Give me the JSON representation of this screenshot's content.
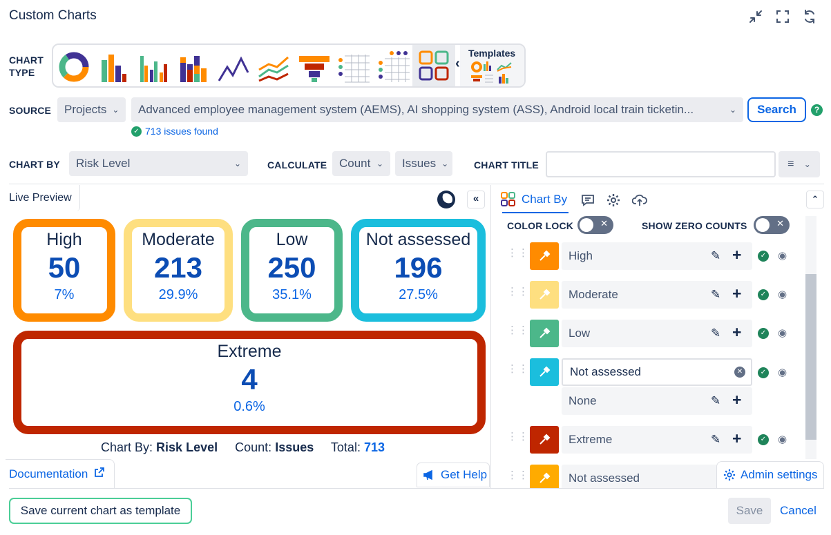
{
  "app": {
    "title": "Custom Charts"
  },
  "chart_type": {
    "label_line1": "CHART",
    "label_line2": "TYPE",
    "templates_label": "Templates"
  },
  "source": {
    "label": "SOURCE",
    "type_select": "Projects",
    "projects_value": "Advanced employee management system (AEMS), AI shopping system (ASS), Android local train ticketin...",
    "search_label": "Search",
    "help": "?",
    "found_text": "713 issues found"
  },
  "config": {
    "chart_by_label": "CHART BY",
    "chart_by_value": "Risk Level",
    "calculate_label": "CALCULATE",
    "calc_function": "Count",
    "calc_target": "Issues",
    "chart_title_label": "CHART TITLE",
    "chart_title_value": ""
  },
  "preview": {
    "tab_label": "Live Preview",
    "collapse": "«",
    "summary_chart_by_label": "Chart By:",
    "summary_chart_by_value": "Risk Level",
    "summary_count_label": "Count:",
    "summary_count_value": "Issues",
    "summary_total_label": "Total:",
    "summary_total_value": "713",
    "documentation_link": "Documentation",
    "get_help": "Get Help"
  },
  "cards": [
    {
      "label": "High",
      "value": "50",
      "pct": "7%",
      "color": "#ff8b00"
    },
    {
      "label": "Moderate",
      "value": "213",
      "pct": "29.9%",
      "color": "#fedf80"
    },
    {
      "label": "Low",
      "value": "250",
      "pct": "35.1%",
      "color": "#4cb78a"
    },
    {
      "label": "Not assessed",
      "value": "196",
      "pct": "27.5%",
      "color": "#1bbedd"
    },
    {
      "label": "Extreme",
      "value": "4",
      "pct": "0.6%",
      "color": "#bf2600"
    }
  ],
  "right_panel": {
    "tab_chart_by": "Chart By",
    "color_lock_label": "COLOR LOCK",
    "show_zero_label": "SHOW ZERO COUNTS",
    "items": [
      {
        "label": "High",
        "color": "#ff8b00"
      },
      {
        "label": "Moderate",
        "color": "#fedf80"
      },
      {
        "label": "Low",
        "color": "#4cb78a"
      },
      {
        "label": "Not assessed",
        "color": "#1bbedd"
      },
      {
        "label": "None",
        "color": ""
      },
      {
        "label": "Extreme",
        "color": "#bf2600"
      },
      {
        "label": "Not assessed",
        "color": "#ffab00"
      }
    ],
    "admin_settings": "Admin settings"
  },
  "footer": {
    "save_template": "Save current chart as template",
    "save": "Save",
    "cancel": "Cancel"
  }
}
